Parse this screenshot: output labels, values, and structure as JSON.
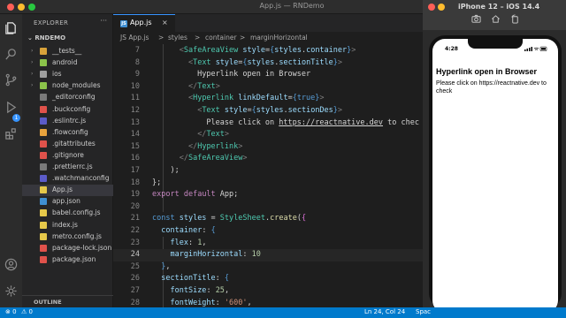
{
  "window": {
    "title": "App.js — RNDemo"
  },
  "sidebar": {
    "header": "EXPLORER",
    "more": "···",
    "root": "RNDEMO",
    "items": [
      {
        "label": "__tests__",
        "type": "folder",
        "color": "#d8a23a"
      },
      {
        "label": "android",
        "type": "folder",
        "color": "#8bc34a"
      },
      {
        "label": "ios",
        "type": "folder",
        "color": "#9e9e9e"
      },
      {
        "label": "node_modules",
        "type": "folder",
        "color": "#8bc34a"
      },
      {
        "label": "_editorconfig",
        "type": "file",
        "color": "#7a7a7a"
      },
      {
        "label": ".buckconfig",
        "type": "file",
        "color": "#e0524b"
      },
      {
        "label": ".eslintrc.js",
        "type": "file",
        "color": "#5b5bc8"
      },
      {
        "label": ".flowconfig",
        "type": "file",
        "color": "#e8a33d"
      },
      {
        "label": ".gitattributes",
        "type": "file",
        "color": "#e0524b"
      },
      {
        "label": ".gitignore",
        "type": "file",
        "color": "#e0524b"
      },
      {
        "label": ".prettierrc.js",
        "type": "file",
        "color": "#7a7a7a"
      },
      {
        "label": ".watchmanconfig",
        "type": "file",
        "color": "#5b5bc8"
      },
      {
        "label": "App.js",
        "type": "file",
        "color": "#e6c84a",
        "selected": true
      },
      {
        "label": "app.json",
        "type": "file",
        "color": "#3f8fd2"
      },
      {
        "label": "babel.config.js",
        "type": "file",
        "color": "#e6c84a"
      },
      {
        "label": "index.js",
        "type": "file",
        "color": "#e6c84a"
      },
      {
        "label": "metro.config.js",
        "type": "file",
        "color": "#e6c84a"
      },
      {
        "label": "package-lock.json",
        "type": "file",
        "color": "#e0524b"
      },
      {
        "label": "package.json",
        "type": "file",
        "color": "#e0524b"
      }
    ],
    "outline": "OUTLINE"
  },
  "activity": {
    "badge": "1"
  },
  "tab": {
    "label": "App.js",
    "icon": "JS",
    "close": "×"
  },
  "breadcrumb": [
    "JS App.js",
    ">",
    "styles",
    ">",
    "container",
    ">",
    "marginHorizontal"
  ],
  "editor": {
    "current_line": 24,
    "lines": [
      {
        "n": "7",
        "tokens": [
          [
            "      ",
            ""
          ],
          [
            "<",
            "p"
          ],
          [
            "SafeAreaView",
            "tag"
          ],
          [
            " ",
            ""
          ],
          [
            "style",
            "attr"
          ],
          [
            "=",
            ""
          ],
          [
            "{",
            "kw2"
          ],
          [
            "styles",
            "attr"
          ],
          [
            ".",
            ""
          ],
          [
            "container",
            "attr"
          ],
          [
            "}",
            "kw2"
          ],
          [
            ">",
            "p"
          ]
        ]
      },
      {
        "n": "8",
        "tokens": [
          [
            "        ",
            ""
          ],
          [
            "<",
            "p"
          ],
          [
            "Text",
            "tag"
          ],
          [
            " ",
            ""
          ],
          [
            "style",
            "attr"
          ],
          [
            "=",
            ""
          ],
          [
            "{",
            "kw2"
          ],
          [
            "styles",
            "attr"
          ],
          [
            ".",
            ""
          ],
          [
            "sectionTitle",
            "attr"
          ],
          [
            "}",
            "kw2"
          ],
          [
            ">",
            "p"
          ]
        ]
      },
      {
        "n": "9",
        "tokens": [
          [
            "          Hyperlink open in Browser",
            ""
          ]
        ]
      },
      {
        "n": "10",
        "tokens": [
          [
            "        ",
            ""
          ],
          [
            "</",
            "p"
          ],
          [
            "Text",
            "tag"
          ],
          [
            ">",
            "p"
          ]
        ]
      },
      {
        "n": "11",
        "tokens": [
          [
            "        ",
            ""
          ],
          [
            "<",
            "p"
          ],
          [
            "Hyperlink",
            "tag"
          ],
          [
            " ",
            ""
          ],
          [
            "linkDefault",
            "attr"
          ],
          [
            "=",
            ""
          ],
          [
            "{",
            "kw2"
          ],
          [
            "true",
            "kw2"
          ],
          [
            "}",
            "kw2"
          ],
          [
            ">",
            "p"
          ]
        ]
      },
      {
        "n": "12",
        "tokens": [
          [
            "          ",
            ""
          ],
          [
            "<",
            "p"
          ],
          [
            "Text",
            "tag"
          ],
          [
            " ",
            ""
          ],
          [
            "style",
            "attr"
          ],
          [
            "=",
            ""
          ],
          [
            "{",
            "kw2"
          ],
          [
            "styles",
            "attr"
          ],
          [
            ".",
            ""
          ],
          [
            "sectionDes",
            "attr"
          ],
          [
            "}",
            "kw2"
          ],
          [
            ">",
            "p"
          ]
        ]
      },
      {
        "n": "13",
        "tokens": [
          [
            "            Please click on ",
            ""
          ],
          [
            "https://reactnative.dev",
            "link"
          ],
          [
            " to chec",
            ""
          ]
        ]
      },
      {
        "n": "14",
        "tokens": [
          [
            "          ",
            ""
          ],
          [
            "</",
            "p"
          ],
          [
            "Text",
            "tag"
          ],
          [
            ">",
            "p"
          ]
        ]
      },
      {
        "n": "15",
        "tokens": [
          [
            "        ",
            ""
          ],
          [
            "</",
            "p"
          ],
          [
            "Hyperlink",
            "tag"
          ],
          [
            ">",
            "p"
          ]
        ]
      },
      {
        "n": "16",
        "tokens": [
          [
            "      ",
            ""
          ],
          [
            "</",
            "p"
          ],
          [
            "SafeAreaView",
            "tag"
          ],
          [
            ">",
            "p"
          ]
        ]
      },
      {
        "n": "17",
        "tokens": [
          [
            "    );",
            ""
          ]
        ]
      },
      {
        "n": "18",
        "tokens": [
          [
            "};",
            ""
          ]
        ]
      },
      {
        "n": "19",
        "tokens": [
          [
            "export",
            "kw"
          ],
          [
            " ",
            ""
          ],
          [
            "default",
            "kw"
          ],
          [
            " App;",
            ""
          ]
        ]
      },
      {
        "n": "20",
        "tokens": [
          [
            "",
            ""
          ]
        ]
      },
      {
        "n": "21",
        "tokens": [
          [
            "const",
            "kw2"
          ],
          [
            " ",
            ""
          ],
          [
            "styles",
            "attr"
          ],
          [
            " = ",
            ""
          ],
          [
            "StyleSheet",
            "tag"
          ],
          [
            ".",
            ""
          ],
          [
            "create",
            "fn"
          ],
          [
            "(",
            ""
          ],
          [
            "{",
            "brace"
          ]
        ]
      },
      {
        "n": "22",
        "tokens": [
          [
            "  ",
            ""
          ],
          [
            "container",
            "attr"
          ],
          [
            ": ",
            ""
          ],
          [
            "{",
            "kw2"
          ]
        ]
      },
      {
        "n": "23",
        "tokens": [
          [
            "    ",
            ""
          ],
          [
            "flex",
            "attr"
          ],
          [
            ": ",
            ""
          ],
          [
            "1",
            "num"
          ],
          [
            ",",
            ""
          ]
        ]
      },
      {
        "n": "24",
        "tokens": [
          [
            "    ",
            ""
          ],
          [
            "marginHorizontal",
            "attr"
          ],
          [
            ": ",
            ""
          ],
          [
            "10",
            "num"
          ]
        ]
      },
      {
        "n": "25",
        "tokens": [
          [
            "  ",
            ""
          ],
          [
            "}",
            "kw2"
          ],
          [
            ",",
            ""
          ]
        ]
      },
      {
        "n": "26",
        "tokens": [
          [
            "  ",
            ""
          ],
          [
            "sectionTitle",
            "attr"
          ],
          [
            ": ",
            ""
          ],
          [
            "{",
            "kw2"
          ]
        ]
      },
      {
        "n": "27",
        "tokens": [
          [
            "    ",
            ""
          ],
          [
            "fontSize",
            "attr"
          ],
          [
            ": ",
            ""
          ],
          [
            "25",
            "num"
          ],
          [
            ",",
            ""
          ]
        ]
      },
      {
        "n": "28",
        "tokens": [
          [
            "    ",
            ""
          ],
          [
            "fontWeight",
            "attr"
          ],
          [
            ": ",
            ""
          ],
          [
            "'600'",
            "str"
          ],
          [
            ",",
            ""
          ]
        ]
      }
    ]
  },
  "statusbar": {
    "errors": "⊗ 0",
    "warnings": "⚠ 0",
    "position": "Ln 24, Col 24",
    "spaces": "Spac"
  },
  "simulator": {
    "title": "iPhone 12 – iOS 14.4",
    "time": "4:28",
    "app_title": "Hyperlink open in Browser",
    "app_desc": "Please click on https://reactnative.dev to check"
  }
}
